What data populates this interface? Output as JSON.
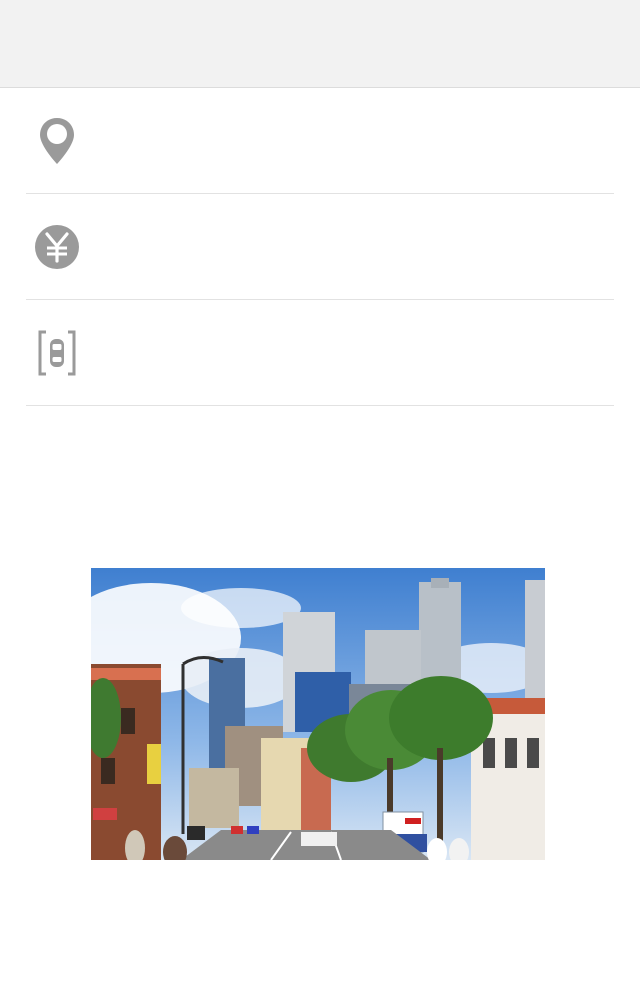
{
  "header": {
    "title": ""
  },
  "rows": [
    {
      "icon": "location-pin-icon",
      "label": ""
    },
    {
      "icon": "yen-coin-icon",
      "label": ""
    },
    {
      "icon": "parking-car-icon",
      "label": ""
    }
  ],
  "colors": {
    "icon_gray": "#9a9a9a",
    "divider": "#e2e2e2",
    "header_bg": "#f2f2f2"
  },
  "photo": {
    "subject": "city-street-photo"
  }
}
